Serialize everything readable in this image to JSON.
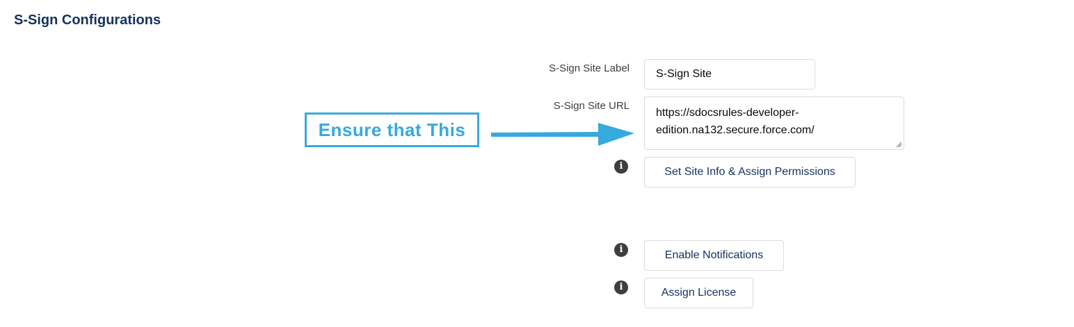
{
  "section": {
    "title": "S-Sign Configurations"
  },
  "fields": {
    "site_label": {
      "label": "S-Sign Site Label",
      "value": "S-Sign Site"
    },
    "site_url": {
      "label": "S-Sign Site URL",
      "value": "https://sdocsrules-developer-edition.na132.secure.force.com/"
    }
  },
  "buttons": {
    "set_site_info": "Set Site Info & Assign Permissions",
    "enable_notifications": "Enable Notifications",
    "assign_license": "Assign License"
  },
  "annotation": {
    "callout_text": "Ensure that This",
    "color": "#36a9dd"
  },
  "icons": {
    "info": "info-icon"
  },
  "colors": {
    "title": "#16325c",
    "label": "#3e3e3c",
    "border": "#dddbda",
    "button_text": "#16325c",
    "info_icon": "#3e3e3c"
  }
}
